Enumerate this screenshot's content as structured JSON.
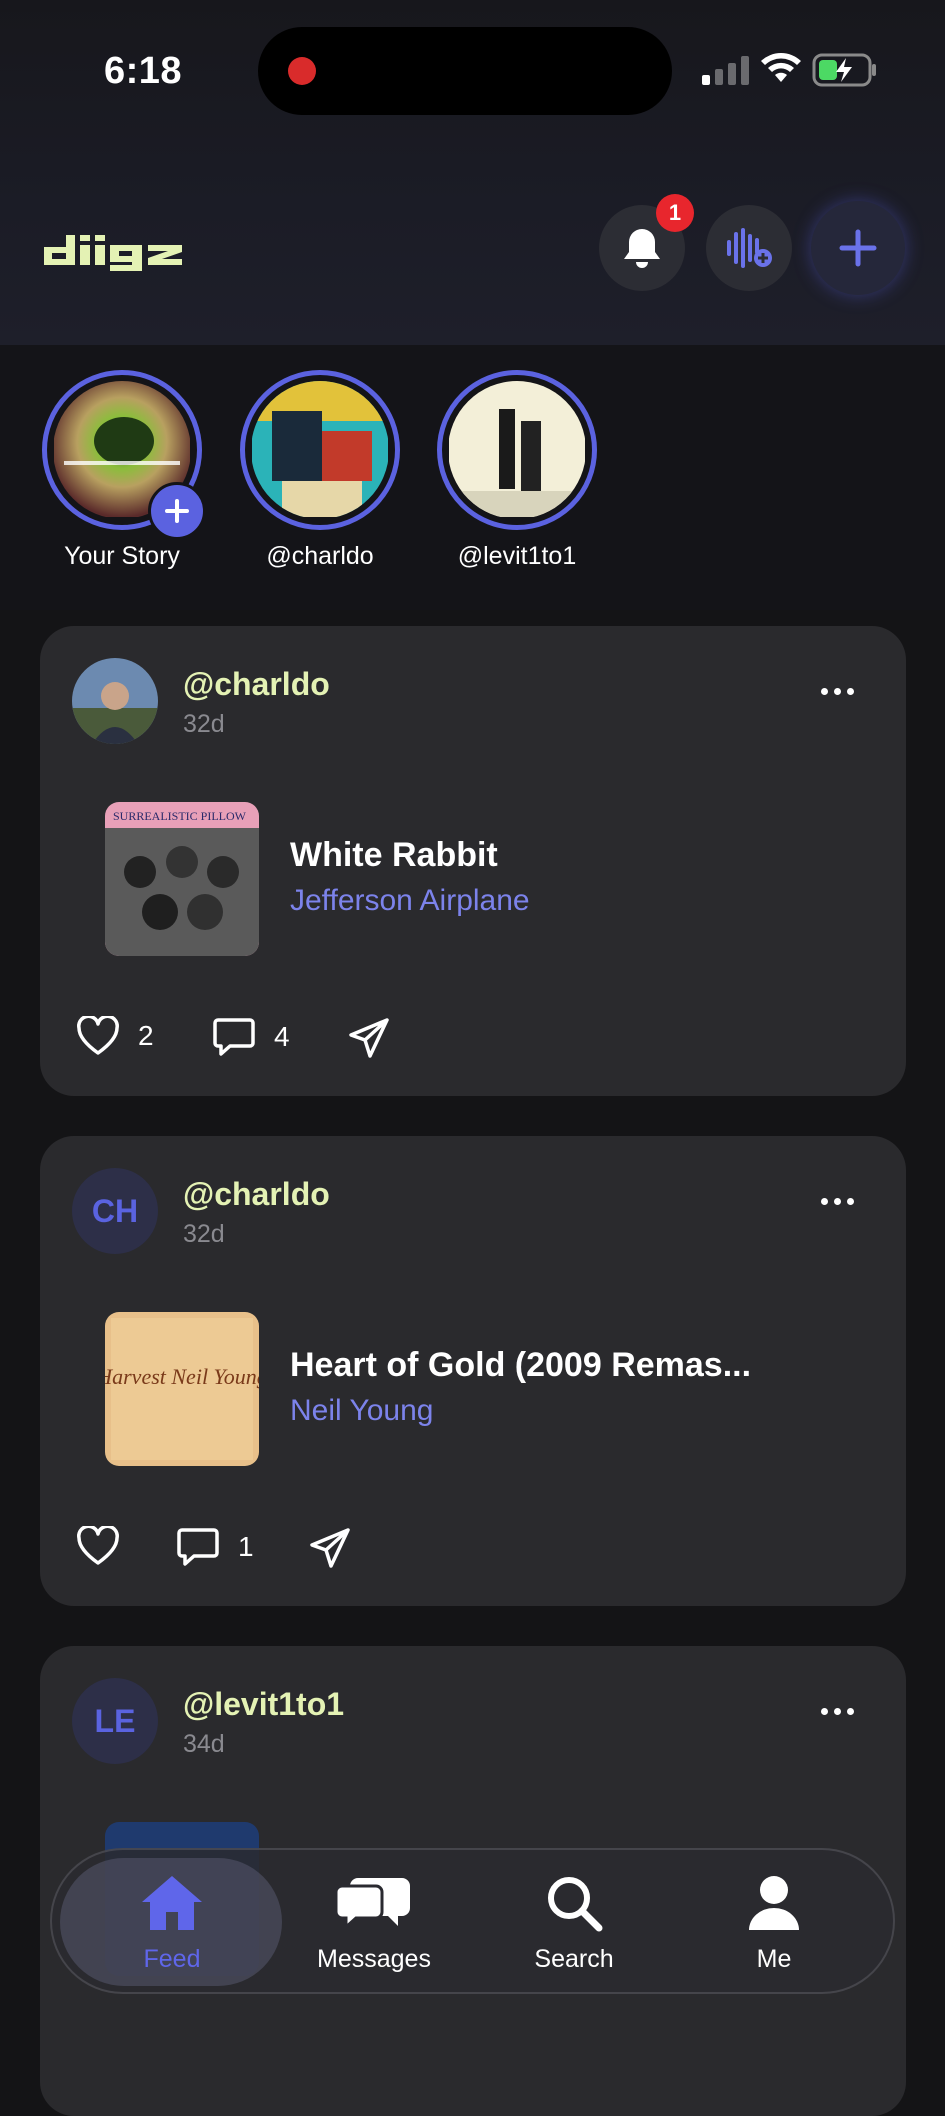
{
  "status_bar": {
    "time": "6:18"
  },
  "header": {
    "logo_text": "diigz",
    "notification_count": "1"
  },
  "stories": [
    {
      "label": "Your Story"
    },
    {
      "label": "@charldo"
    },
    {
      "label": "@levit1to1"
    }
  ],
  "posts": [
    {
      "username": "@charldo",
      "ago": "32d",
      "song": "White Rabbit",
      "artist": "Jefferson Airplane",
      "likes": "2",
      "comments": "4",
      "cover_text": "SURREALISTIC PILLOW"
    },
    {
      "username": "@charldo",
      "avatar_initials": "CH",
      "ago": "32d",
      "song": "Heart of Gold (2009 Remas...",
      "artist": "Neil Young",
      "likes": "",
      "comments": "1",
      "cover_text": "Harvest Neil Young"
    },
    {
      "username": "@levit1to1",
      "avatar_initials": "LE",
      "ago": "34d"
    }
  ],
  "nav": [
    {
      "label": "Feed"
    },
    {
      "label": "Messages"
    },
    {
      "label": "Search"
    },
    {
      "label": "Me"
    }
  ],
  "colors": {
    "accent": "#5b62e0",
    "username": "#e4f2b4",
    "artist": "#7c83eb"
  }
}
